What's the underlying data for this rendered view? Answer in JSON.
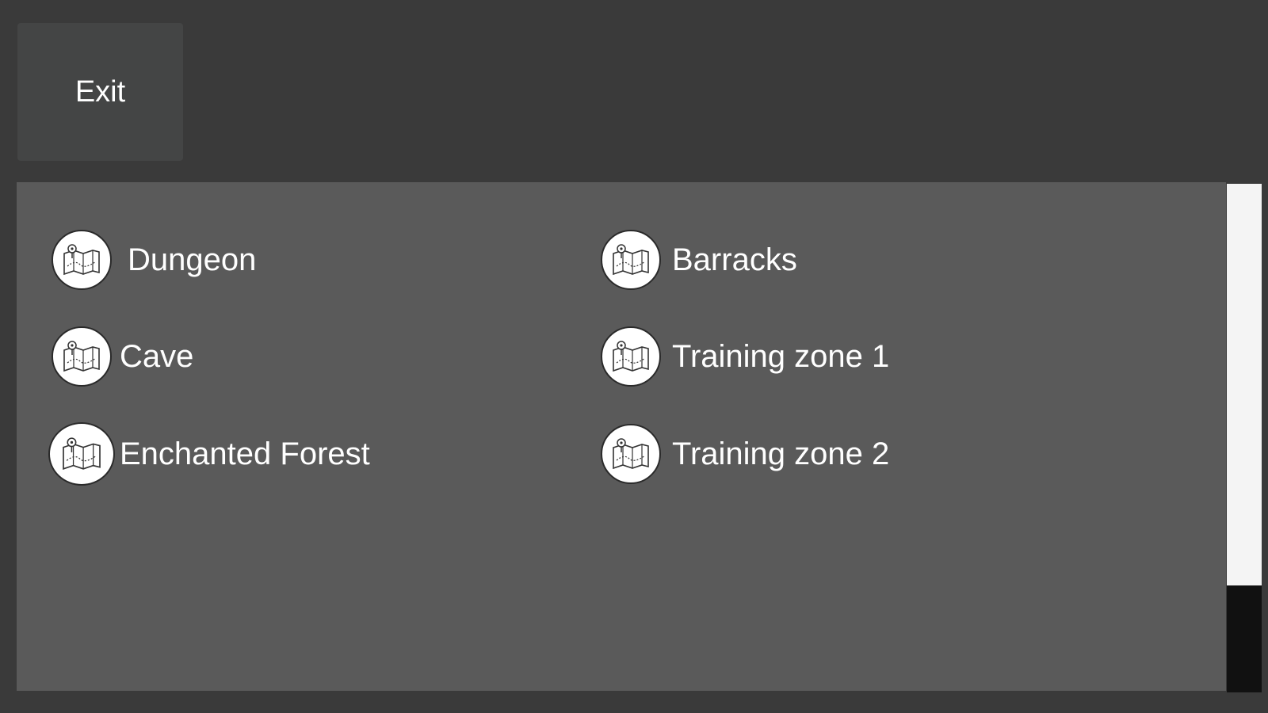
{
  "toolbar": {
    "exit_label": "Exit"
  },
  "locations": [
    {
      "label": "Dungeon",
      "icon": "map-pin-icon"
    },
    {
      "label": "Barracks",
      "icon": "map-pin-icon"
    },
    {
      "label": "Cave",
      "icon": "map-pin-icon"
    },
    {
      "label": "Training zone 1",
      "icon": "map-pin-icon"
    },
    {
      "label": "Enchanted Forest",
      "icon": "map-pin-icon"
    },
    {
      "label": "Training zone 2",
      "icon": "map-pin-icon"
    }
  ],
  "scroll": {
    "visible_fraction": 0.79,
    "position_fraction": 0.0
  },
  "colors": {
    "background": "#3a3a3a",
    "panel": "#5a5a5a",
    "button": "#444545",
    "text": "#ffffff",
    "scroll_thumb": "#f4f4f4",
    "scroll_track": "#111111"
  }
}
